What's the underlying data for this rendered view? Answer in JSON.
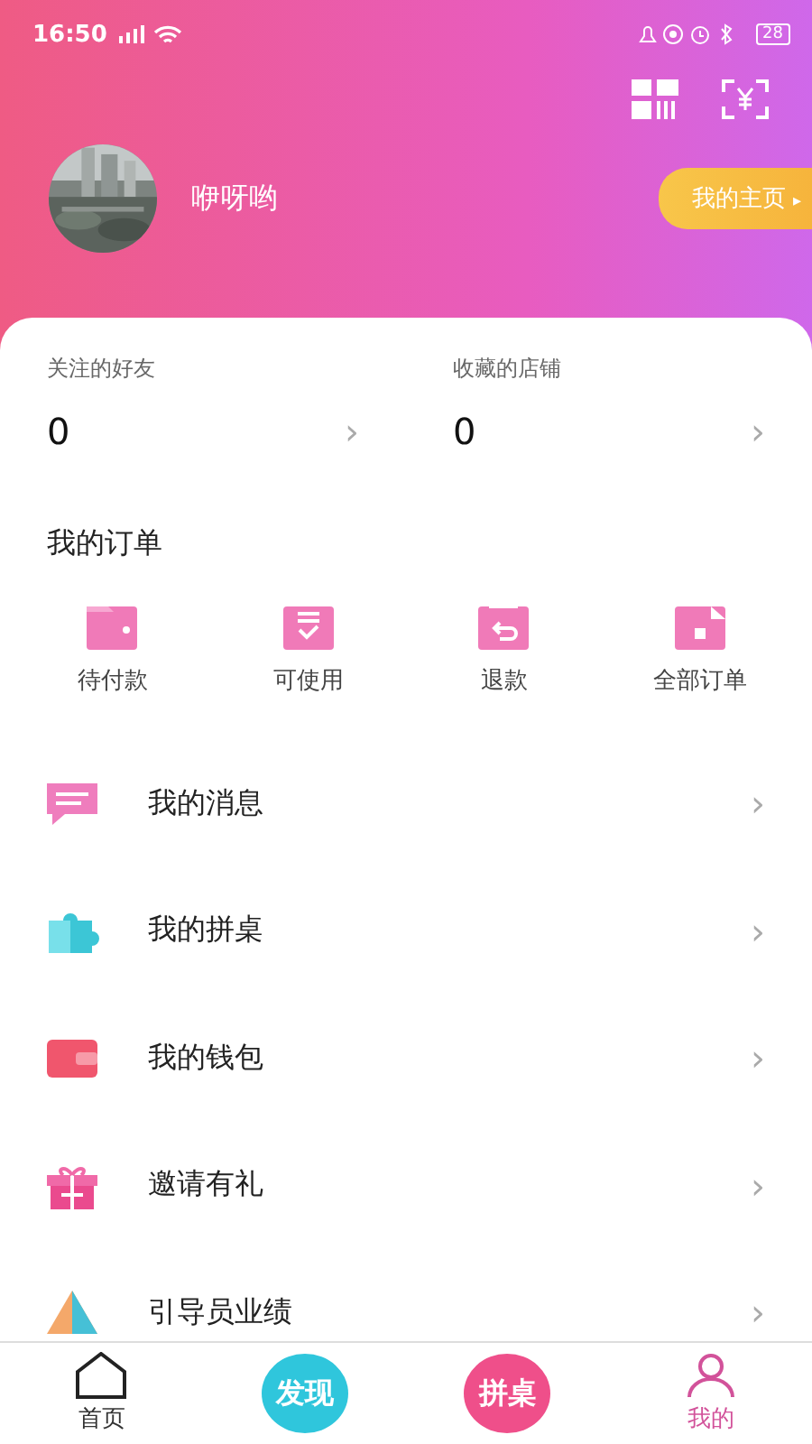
{
  "status_bar": {
    "time": "16:50",
    "battery": "28"
  },
  "profile": {
    "name": "咿呀哟",
    "home_button": "我的主页",
    "home_arrow": "▸"
  },
  "stats": [
    {
      "label": "关注的好友",
      "value": "0",
      "arrow": "›"
    },
    {
      "label": "收藏的店铺",
      "value": "0",
      "arrow": "›"
    }
  ],
  "orders": {
    "title": "我的订单",
    "items": [
      {
        "label": "待付款",
        "kind": "wallet"
      },
      {
        "label": "可使用",
        "kind": "check"
      },
      {
        "label": "退款",
        "kind": "refund"
      },
      {
        "label": "全部订单",
        "kind": "all"
      }
    ]
  },
  "menu": [
    {
      "label": "我的消息",
      "kind": "message",
      "arrow": "›"
    },
    {
      "label": "我的拼桌",
      "kind": "puzzle",
      "arrow": "›"
    },
    {
      "label": "我的钱包",
      "kind": "wallet",
      "arrow": "›"
    },
    {
      "label": "邀请有礼",
      "kind": "gift",
      "arrow": "›"
    },
    {
      "label": "引导员业绩",
      "kind": "chart",
      "arrow": "›"
    }
  ],
  "tab_bar": [
    {
      "label": "首页",
      "kind": "home",
      "selected": false
    },
    {
      "label": "发现",
      "kind": "bubble",
      "color": "#2fc6dc",
      "selected": false
    },
    {
      "label": "拼桌",
      "kind": "bubble",
      "color": "#ef4f8a",
      "selected": false
    },
    {
      "label": "我的",
      "kind": "person",
      "selected": true
    }
  ]
}
